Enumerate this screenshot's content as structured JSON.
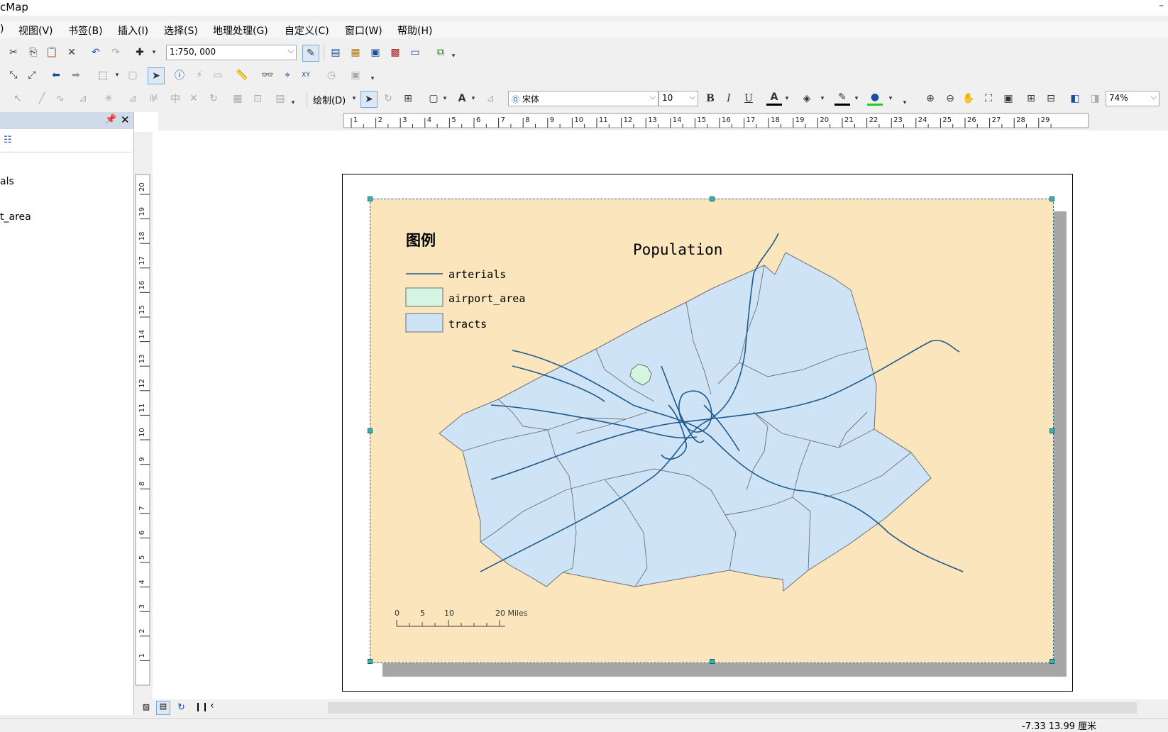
{
  "window": {
    "title": "cMap",
    "minimize": "–"
  },
  "menu": [
    "视图(V)",
    "书签(B)",
    "插入(I)",
    "选择(S)",
    "地理处理(G)",
    "自定义(C)",
    "窗口(W)",
    "帮助(H)"
  ],
  "menu_leading": ")",
  "toolbar": {
    "scale_value": "1:750, 000",
    "draw_label": "绘制(D)",
    "font_name": "宋体",
    "font_size": "10",
    "zoom_value": "74%",
    "bold": "B",
    "italic": "I",
    "underline": "U",
    "font_color_glyph": "A"
  },
  "toc": {
    "items": [
      "als",
      "t_area"
    ]
  },
  "map": {
    "legend_title": "图例",
    "legend_items": [
      "arterials",
      "airport_area",
      "tracts"
    ],
    "map_title": "Population",
    "scalebar_labels": [
      "0",
      "5",
      "10",
      "20 Miles"
    ]
  },
  "colors": {
    "background": "#fbe5bd",
    "tracts_fill": "#cfe3f7",
    "airport_fill": "#d4f5e2",
    "arterials": "#1e5a8c",
    "selection": "#2ab8b8"
  },
  "rulers": {
    "horizontal": [
      "1",
      "2",
      "3",
      "4",
      "5",
      "6",
      "7",
      "8",
      "9",
      "10",
      "11",
      "12",
      "13",
      "14",
      "15",
      "16",
      "17",
      "18",
      "19",
      "20",
      "21",
      "22",
      "23",
      "24",
      "25",
      "26",
      "27",
      "28",
      "29"
    ],
    "vertical": [
      "20",
      "19",
      "18",
      "17",
      "16",
      "15",
      "14",
      "13",
      "12",
      "11",
      "10",
      "9",
      "8",
      "7",
      "6",
      "5",
      "4",
      "3",
      "2",
      "1"
    ]
  },
  "status": {
    "coordinates": "-7.33  13.99 厘米"
  }
}
